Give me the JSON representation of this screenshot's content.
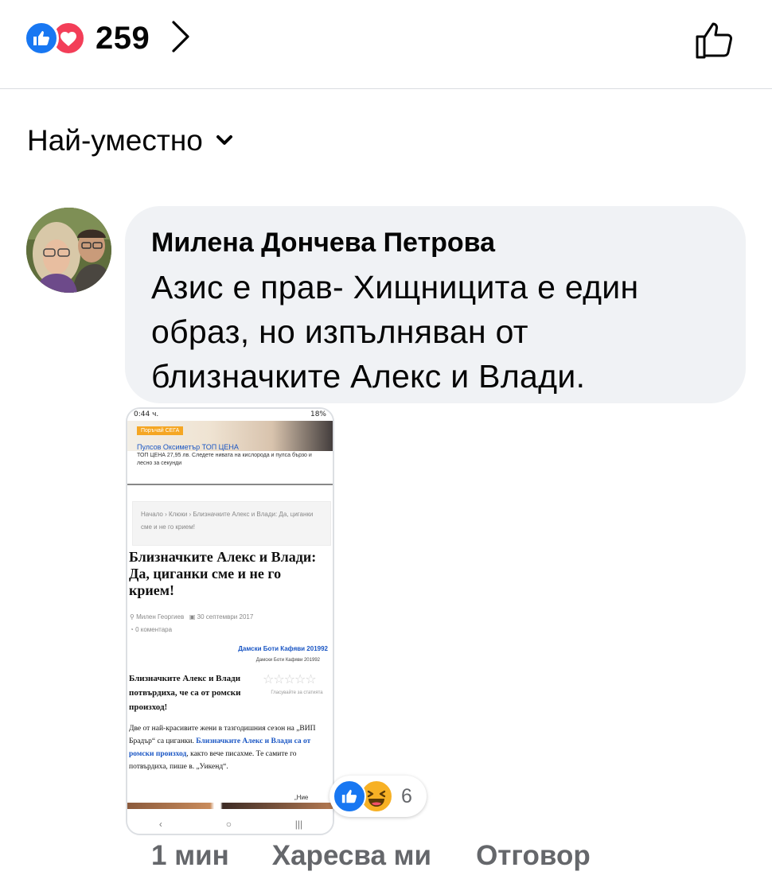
{
  "post": {
    "reaction_count": "259",
    "reaction_icons": [
      "like-icon",
      "love-icon"
    ]
  },
  "sort": {
    "label": "Най-уместно"
  },
  "comment": {
    "author": "Милена Дончева Петрова",
    "text_lines": [
      "Азис е прав- Хищницита е един",
      "образ, но изпълняван от",
      "близначките Алекс и Влади."
    ],
    "time": "1 мин",
    "like_label": "Харесва ми",
    "reply_label": "Отговор",
    "reaction_count": "6",
    "reaction_icons": [
      "like-icon",
      "haha-icon"
    ]
  },
  "attachment": {
    "status_left": "0:44 ч.",
    "status_right": "18%",
    "ad_button": "Поръчай СЕГА",
    "ad_title": "Пулсов Оксиметър ТОП ЦЕНА",
    "ad_body": "ТОП ЦЕНА 27,95 лв. Следете нивата на кислорода и пулса бързо и лесно за секунди",
    "breadcrumbs": "Начало › Клюки › Близначките Алекс и Влади: Да, циганки сме и не го крием!",
    "article_title": "Близначките Алекс и Влади: Да, циганки сме и не го крием!",
    "author": "Милен Георгиев",
    "date": "30 септември 2017",
    "comments": "0 коментара",
    "brand_link": "Дамски Боти Кафяви 201992",
    "brand_sub": "Дамски Боти Кафяви 201992",
    "subtitle": "Близначките Алекс и Влади потвърдиха, че са от ромски произход!",
    "vote_label": "Гласувайте за статията",
    "body_start": "Две от най-красивите жени в тазгодишния сезон на „ВИП Брадър“ са циганки.",
    "body_link": "Близначките Алекс и Влади са от ромски произход",
    "body_end": ", както вече писахме. Те самите го потвърдиха, пише в. „Уикенд“.",
    "cut_text": "„Ние"
  },
  "colors": {
    "like_blue": "#1877f2",
    "love_red": "#f33e58",
    "haha_yellow": "#f7b125",
    "bubble_bg": "#f0f2f5",
    "meta_gray": "#65676b"
  }
}
